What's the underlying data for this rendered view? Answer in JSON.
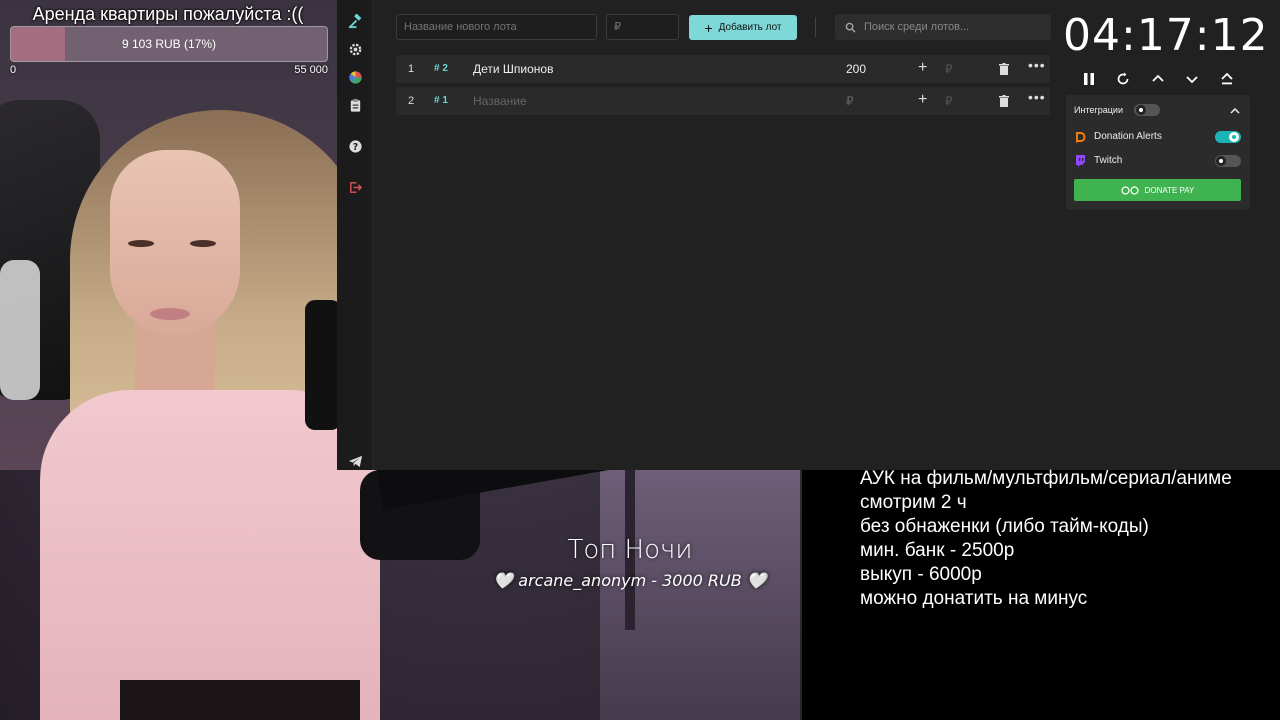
{
  "goal": {
    "title": "Аренда квартиры пожалуйста :((",
    "amount": "9 103 RUB (17%)",
    "percent": 17,
    "min": "0",
    "max": "55 000"
  },
  "toolbar": {
    "new_lot_placeholder": "Название нового лота",
    "amount_placeholder": "₽",
    "add_label": "Добавить лот",
    "search_placeholder": "Поиск среди лотов..."
  },
  "lots": [
    {
      "num": "1",
      "tag": "# 2",
      "name": "Дети Шпионов",
      "amount": "200",
      "rub": "₽"
    },
    {
      "num": "2",
      "tag": "# 1",
      "name": "Название",
      "amount": "₽",
      "rub": "₽"
    }
  ],
  "timer": "04:17:12",
  "integrations": {
    "title": "Интеграции",
    "items": [
      {
        "name": "Donation Alerts",
        "enabled": true,
        "color": "#f57d07"
      },
      {
        "name": "Twitch",
        "enabled": false,
        "color": "#9146ff"
      }
    ],
    "donatepay_label": "DONATE PAY"
  },
  "top_night": {
    "title": "Топ Ночи",
    "entry": "🤍 arcane_anonym - 3000 RUB 🤍"
  },
  "rules": [
    "АУК на фильм/мультфильм/сериал/аниме",
    "смотрим 2 ч",
    "без обнаженки (либо тайм-коды)",
    "мин. банк - 2500р",
    "выкуп - 6000р",
    "можно донатить на минус"
  ],
  "colors": {
    "accent": "#7fd8d8",
    "panel": "#212121",
    "donatepay": "#3fb34f"
  }
}
